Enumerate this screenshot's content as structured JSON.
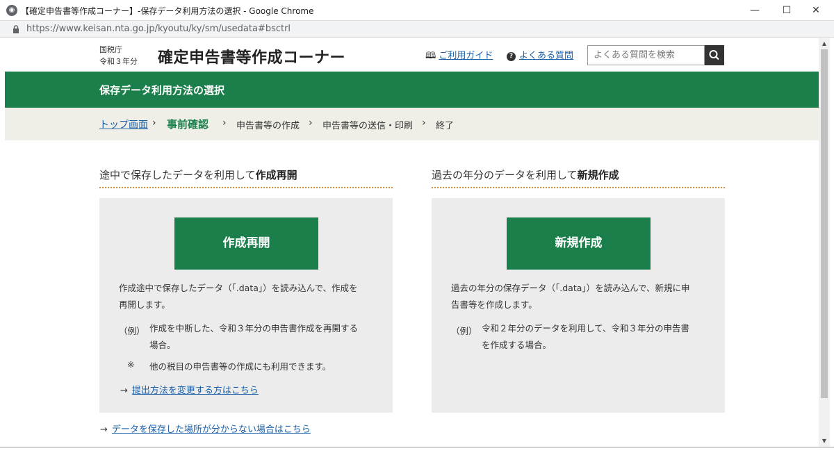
{
  "window": {
    "title": "【確定申告書等作成コーナー】-保存データ利用方法の選択 - Google Chrome",
    "minimize": "—",
    "maximize": "☐",
    "close": "✕",
    "url": "https://www.keisan.nta.go.jp/kyoutu/ky/sm/usedata#bsctrl"
  },
  "header": {
    "agency": "国税庁",
    "year": "令和３年分",
    "site_title": "確定申告書等作成コーナー",
    "guide_link": "ご利用ガイド",
    "faq_link": "よくある質問",
    "search_placeholder": "よくある質問を検索"
  },
  "section_title": "保存データ利用方法の選択",
  "steps": {
    "top": "トップ画面",
    "current": "事前確認",
    "step3": "申告書等の作成",
    "step4": "申告書等の送信・印刷",
    "step5": "終了",
    "separator": "›"
  },
  "left_panel": {
    "heading_prefix": "途中で保存したデータを利用して",
    "heading_bold": "作成再開",
    "button": "作成再開",
    "desc_line1": "作成途中で保存したデータ（「.data」）を読み込んで、作成を",
    "desc_line2": "再開します。",
    "example_label": "（例）",
    "example_line1": "作成を中断した、令和３年分の申告書作成を再開する",
    "example_line2": "場合。",
    "note_mark": "※",
    "note_text": "他の税目の申告書等の作成にも利用できます。",
    "link": "提出方法を変更する方はこちら"
  },
  "right_panel": {
    "heading_prefix": "過去の年分のデータを利用して",
    "heading_bold": "新規作成",
    "button": "新規作成",
    "desc_line1": "過去の年分の保存データ（「.data」）を読み込んで、新規に申",
    "desc_line2": "告書等を作成します。",
    "example_label": "（例）",
    "example_line1": "令和２年分のデータを利用して、令和３年分の申告書",
    "example_line2": "を作成する場合。"
  },
  "bottom_link": "データを保存した場所が分からない場合はこちら",
  "icons": {
    "arrow": "→",
    "book": "🕮",
    "help": "?"
  },
  "colors": {
    "brand_green": "#1a7f4b",
    "link_blue": "#1a5fa8",
    "dotted_orange": "#d9883a",
    "panel_gray": "#ececec",
    "steps_beige": "#efeee7"
  }
}
